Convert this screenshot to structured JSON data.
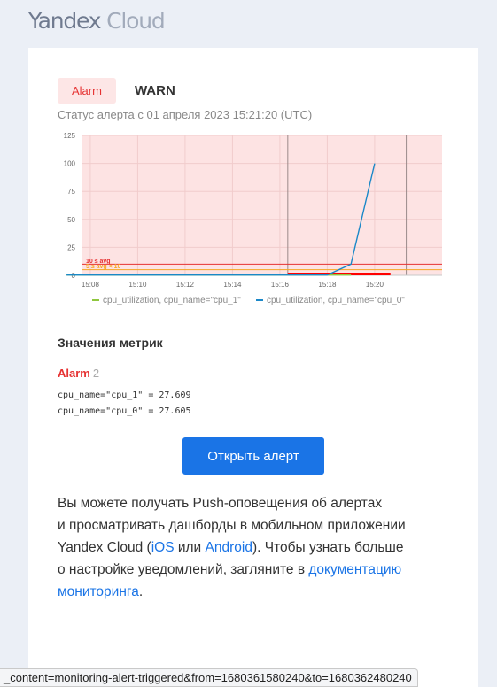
{
  "logo": {
    "word1": "Yandex",
    "word2": "Cloud"
  },
  "alert": {
    "badge": "Alarm",
    "status": "WARN",
    "subtitle": "Статус алерта с 01 апреля 2023 15:21:20 (UTC)"
  },
  "colors": {
    "alarm": "#e63232",
    "warn": "#f5a623",
    "series_cpu_1": "#8fc73e",
    "series_cpu_0": "#1b88c8",
    "accent": "#1a74e6"
  },
  "chart_data": {
    "type": "line",
    "ylim": [
      0,
      125
    ],
    "yticks": [
      "0",
      "25",
      "50",
      "75",
      "100",
      "125"
    ],
    "xticks": [
      "15:08",
      "15:10",
      "15:12",
      "15:14",
      "15:16",
      "15:18",
      "15:20"
    ],
    "grid": true,
    "legend_position": "bottom",
    "thresholds": [
      {
        "label": "10 ≤ avg",
        "value": 10,
        "color": "#e63232"
      },
      {
        "label": "5 ≤ avg < 10",
        "value": 5,
        "color": "#f5a623"
      }
    ],
    "series": [
      {
        "name": "cpu_utilization, cpu_name=\"cpu_1\"",
        "color": "#8fc73e",
        "points": [
          [
            "15:07",
            0.3
          ],
          [
            "15:18",
            0.3
          ],
          [
            "15:19",
            0.3
          ]
        ]
      },
      {
        "name": "cpu_utilization, cpu_name=\"cpu_0\"",
        "color": "#1b88c8",
        "points": [
          [
            "15:07",
            0.3
          ],
          [
            "15:18",
            0.3
          ],
          [
            "15:19",
            10
          ],
          [
            "15:20",
            100
          ]
        ]
      }
    ]
  },
  "metrics": {
    "title": "Значения метрик",
    "alarm_label": "Alarm",
    "alarm_count": "2",
    "rows": [
      "cpu_name=\"cpu_1\" = 27.609",
      "cpu_name=\"cpu_0\" = 27.605"
    ]
  },
  "button": {
    "label": "Открыть алерт"
  },
  "info": {
    "line1": "Вы можете получать Push-оповещения об алертах",
    "line2": "и просматривать дашборды в мобильном приложении",
    "line3_pre": "Yandex Cloud (",
    "ios": "iOS",
    "or": " или ",
    "android": "Android",
    "line3_post": "). Чтобы узнать больше",
    "line4_pre": "о настройке уведомлений, загляните в ",
    "doc1": "документацию",
    "doc2": "мониторинга",
    "end": "."
  },
  "status_bar": "_content=monitoring-alert-triggered&from=1680361580240&to=1680362480240"
}
